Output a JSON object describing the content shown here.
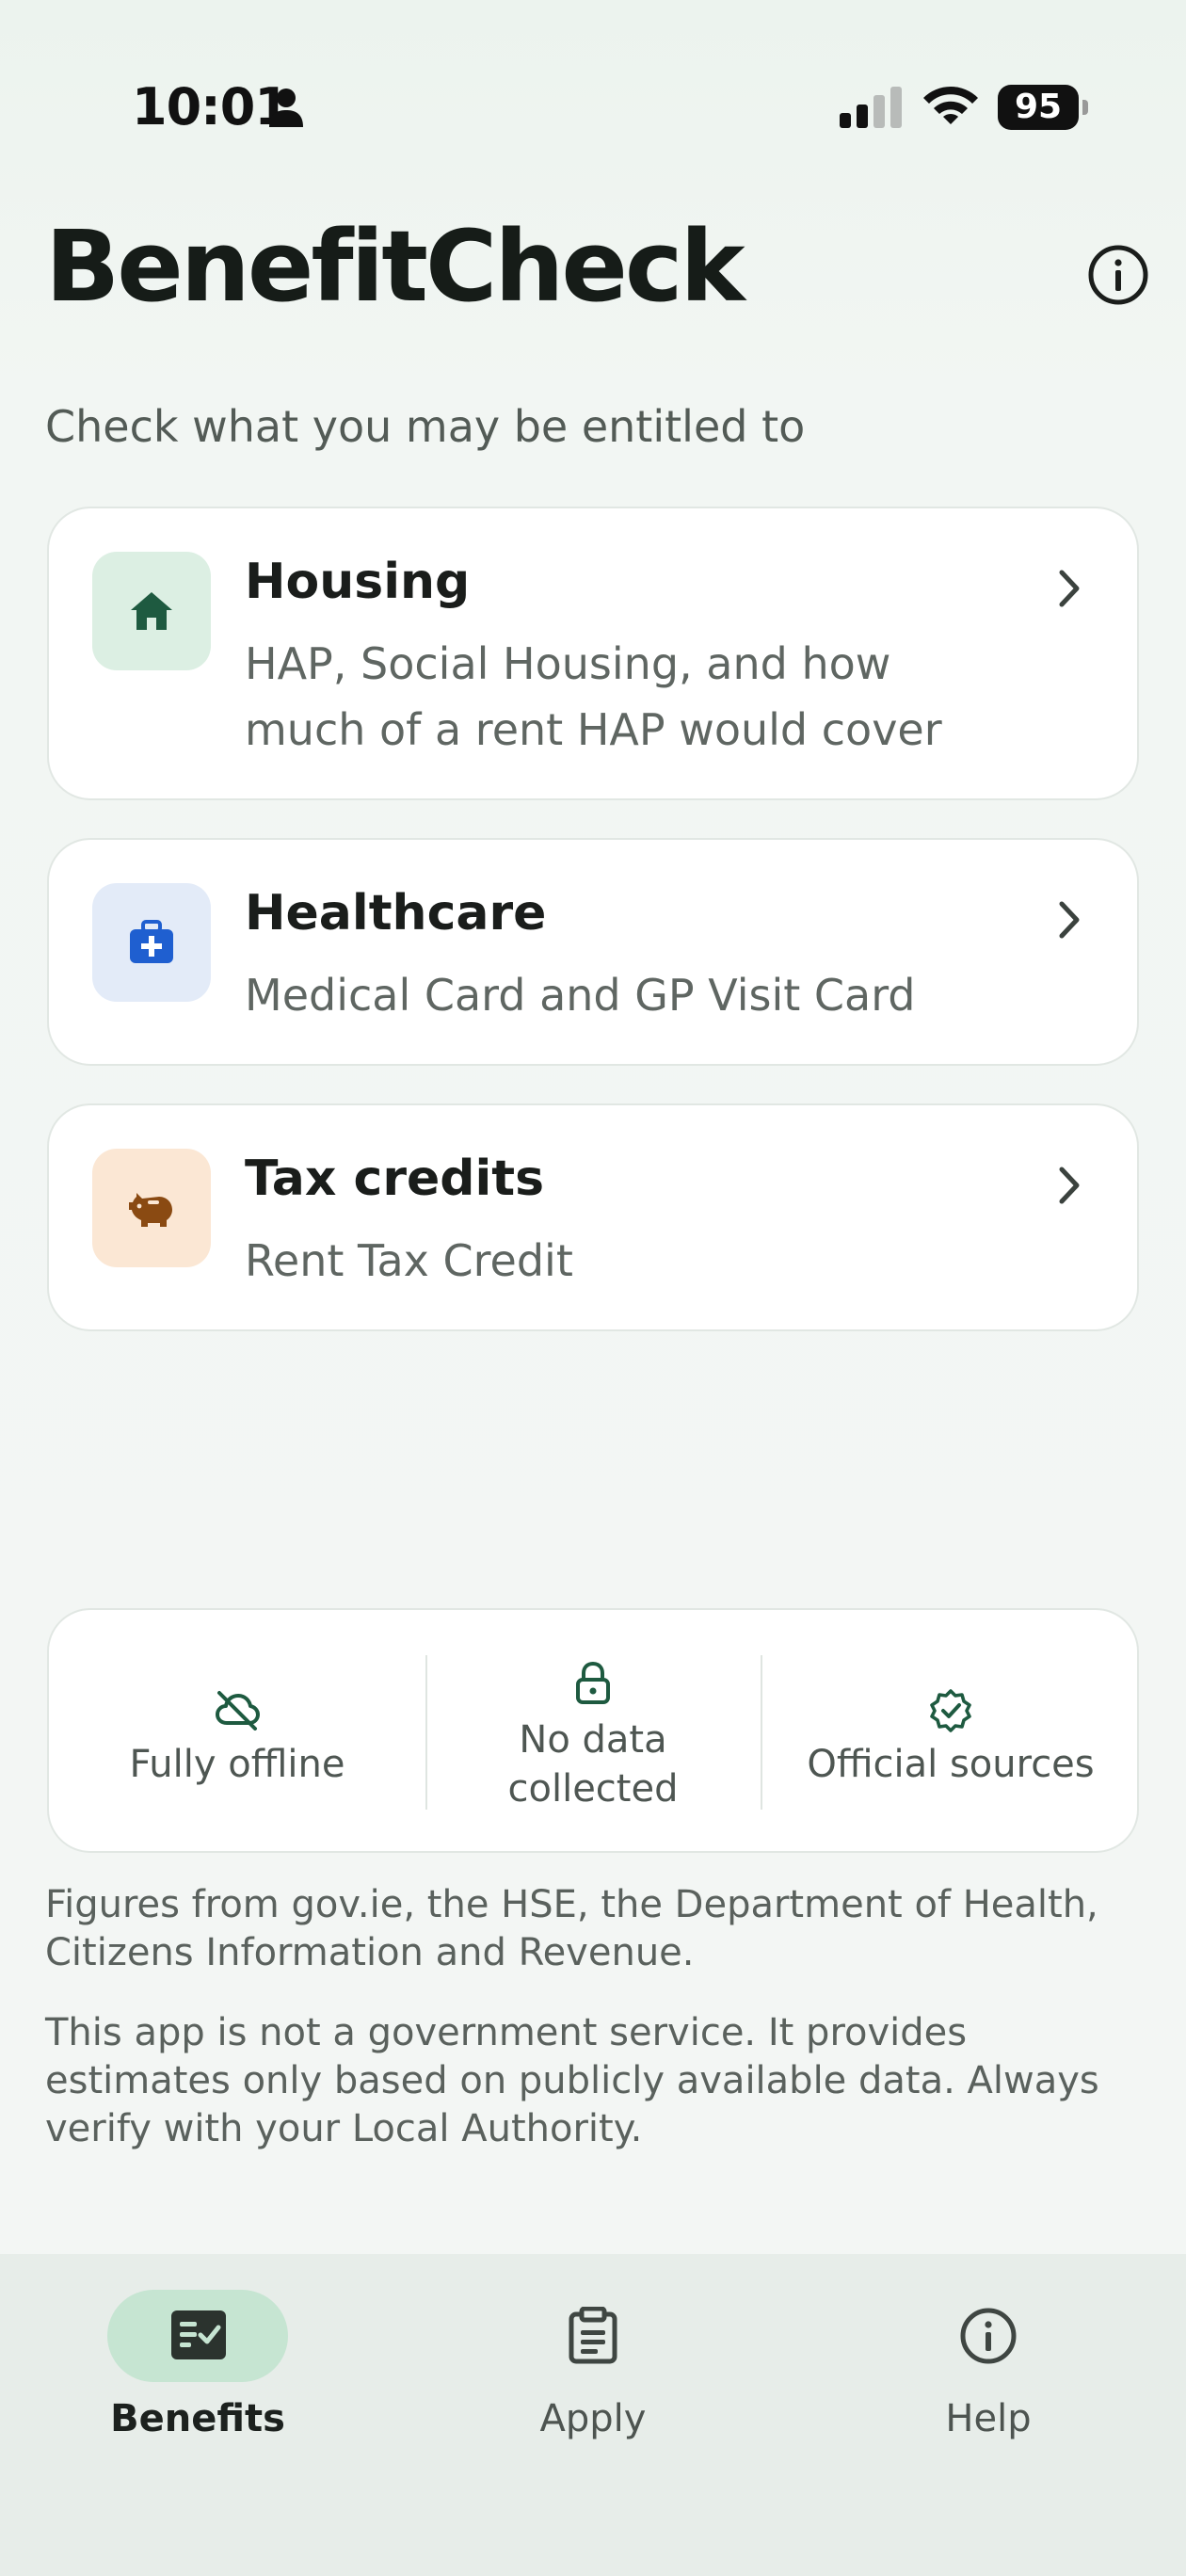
{
  "status_bar": {
    "time": "10:01",
    "battery": "95",
    "icons": [
      "person-icon",
      "signal-icon",
      "wifi-icon",
      "battery-icon"
    ]
  },
  "header": {
    "title": "BenefitCheck",
    "info_icon": "info-circle-icon",
    "subtitle": "Check what you may be entitled to"
  },
  "categories": [
    {
      "title": "Housing",
      "description": "HAP, Social Housing, and how much of a rent HAP would cover",
      "icon": "home-icon",
      "icon_color": "#1e5a40",
      "tile_color": "#dcefe3"
    },
    {
      "title": "Healthcare",
      "description": "Medical Card and GP Visit Card",
      "icon": "medical-kit-icon",
      "icon_color": "#1f5fd0",
      "tile_color": "#e3ebf8"
    },
    {
      "title": "Tax credits",
      "description": "Rent Tax Credit",
      "icon": "piggy-bank-icon",
      "icon_color": "#8a4a12",
      "tile_color": "#fbe7d4"
    }
  ],
  "trust": [
    {
      "label": "Fully offline",
      "icon": "cloud-off-icon"
    },
    {
      "label": "No data collected",
      "icon": "lock-icon"
    },
    {
      "label": "Official sources",
      "icon": "verified-badge-icon"
    }
  ],
  "footnotes": {
    "sources": "Figures from gov.ie, the HSE, the Department of Health, Citizens Information and Revenue.",
    "disclaimer": "This app is not a government service. It provides estimates only based on publicly available data. Always verify with your Local Authority."
  },
  "nav": {
    "items": [
      {
        "label": "Benefits",
        "icon": "checklist-icon",
        "active": true
      },
      {
        "label": "Apply",
        "icon": "clipboard-icon",
        "active": false
      },
      {
        "label": "Help",
        "icon": "info-circle-icon",
        "active": false
      }
    ]
  },
  "colors": {
    "accent": "#c6e5d2",
    "text_primary": "#1a1d1b",
    "text_secondary": "#5f6662"
  }
}
